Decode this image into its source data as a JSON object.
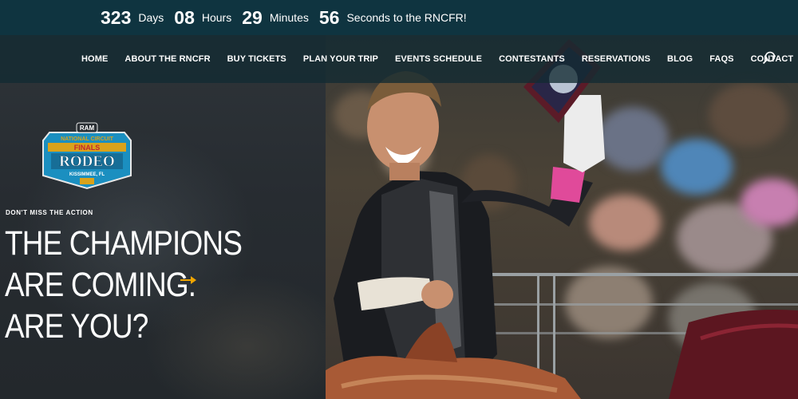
{
  "countdown": {
    "days": "323",
    "days_label": "Days",
    "hours": "08",
    "hours_label": "Hours",
    "minutes": "29",
    "minutes_label": "Minutes",
    "seconds": "56",
    "seconds_label": "Seconds to the RNCFR!"
  },
  "nav": {
    "items": [
      "HOME",
      "ABOUT THE RNCFR",
      "BUY TICKETS",
      "PLAN YOUR TRIP",
      "EVENTS SCHEDULE",
      "CONTESTANTS",
      "RESERVATIONS",
      "BLOG",
      "FAQS",
      "CONTACT"
    ],
    "search_icon": "search-icon"
  },
  "logo": {
    "brand": "RAM",
    "line1": "NATIONAL CIRCUIT",
    "line2": "FINALS",
    "line3": "RODEO",
    "location": "KISSIMMEE, FL",
    "colors": {
      "badge": "#1b8fc0",
      "gold": "#d9a21b",
      "red": "#c4262e"
    }
  },
  "hero": {
    "eyebrow": "DON'T MISS THE ACTION",
    "headline_line1": "THE CHAMPIONS",
    "headline_line2": "ARE COMING.",
    "headline_line3": "ARE YOU?",
    "arrow_color": "#f0a500"
  }
}
